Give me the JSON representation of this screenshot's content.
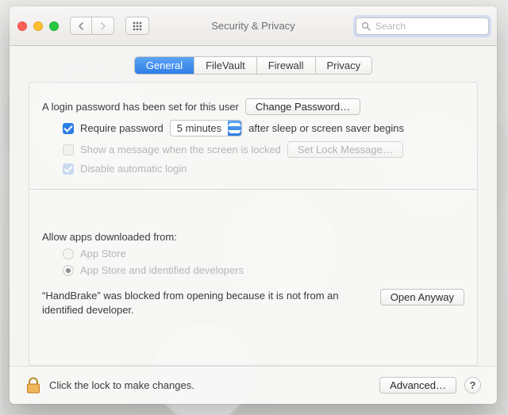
{
  "window": {
    "title": "Security & Privacy"
  },
  "toolbar": {
    "search_placeholder": "Search"
  },
  "tabs": {
    "general": "General",
    "filevault": "FileVault",
    "firewall": "Firewall",
    "privacy": "Privacy",
    "active": "general"
  },
  "general": {
    "login_password_msg": "A login password has been set for this user",
    "change_password_btn": "Change Password…",
    "require_password_label": "Require password",
    "require_password_delay": "5 minutes",
    "require_password_suffix": "after sleep or screen saver begins",
    "show_message_label": "Show a message when the screen is locked",
    "set_lock_message_btn": "Set Lock Message…",
    "disable_auto_login_label": "Disable automatic login",
    "allow_apps_heading": "Allow apps downloaded from:",
    "allow_option_appstore": "App Store",
    "allow_option_identified": "App Store and identified developers",
    "blocked_app_name": "HandBrake",
    "blocked_msg_prefix": "“",
    "blocked_msg_mid": "” was blocked from opening because it is not from an identified developer.",
    "open_anyway_btn": "Open Anyway"
  },
  "footer": {
    "lock_msg": "Click the lock to make changes.",
    "advanced_btn": "Advanced…",
    "help": "?"
  }
}
